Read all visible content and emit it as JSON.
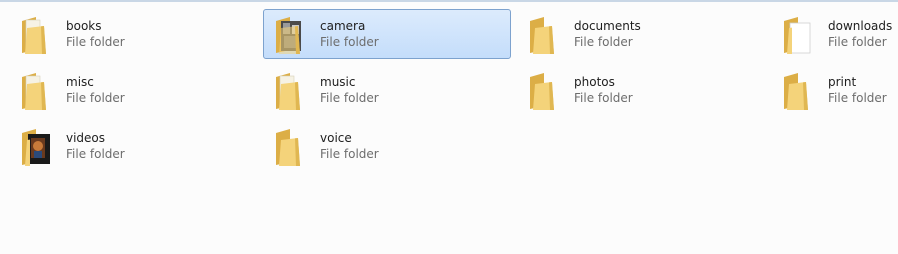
{
  "folders": [
    {
      "name": "books",
      "type": "File folder",
      "icon": "folder-icon",
      "selected": false
    },
    {
      "name": "camera",
      "type": "File folder",
      "icon": "folder-camera-icon",
      "selected": true
    },
    {
      "name": "documents",
      "type": "File folder",
      "icon": "folder-icon",
      "selected": false
    },
    {
      "name": "downloads",
      "type": "File folder",
      "icon": "folder-document-icon",
      "selected": false
    },
    {
      "name": "misc",
      "type": "File folder",
      "icon": "folder-icon",
      "selected": false
    },
    {
      "name": "music",
      "type": "File folder",
      "icon": "folder-icon",
      "selected": false
    },
    {
      "name": "photos",
      "type": "File folder",
      "icon": "folder-icon",
      "selected": false
    },
    {
      "name": "print",
      "type": "File folder",
      "icon": "folder-icon",
      "selected": false
    },
    {
      "name": "videos",
      "type": "File folder",
      "icon": "folder-video-icon",
      "selected": false
    },
    {
      "name": "voice",
      "type": "File folder",
      "icon": "folder-icon",
      "selected": false
    }
  ],
  "colors": {
    "selection_fill": "#c4ddfb",
    "selection_border": "#7da2ce",
    "folder_body": "#f2cf6e",
    "folder_back": "#e2b64c"
  }
}
